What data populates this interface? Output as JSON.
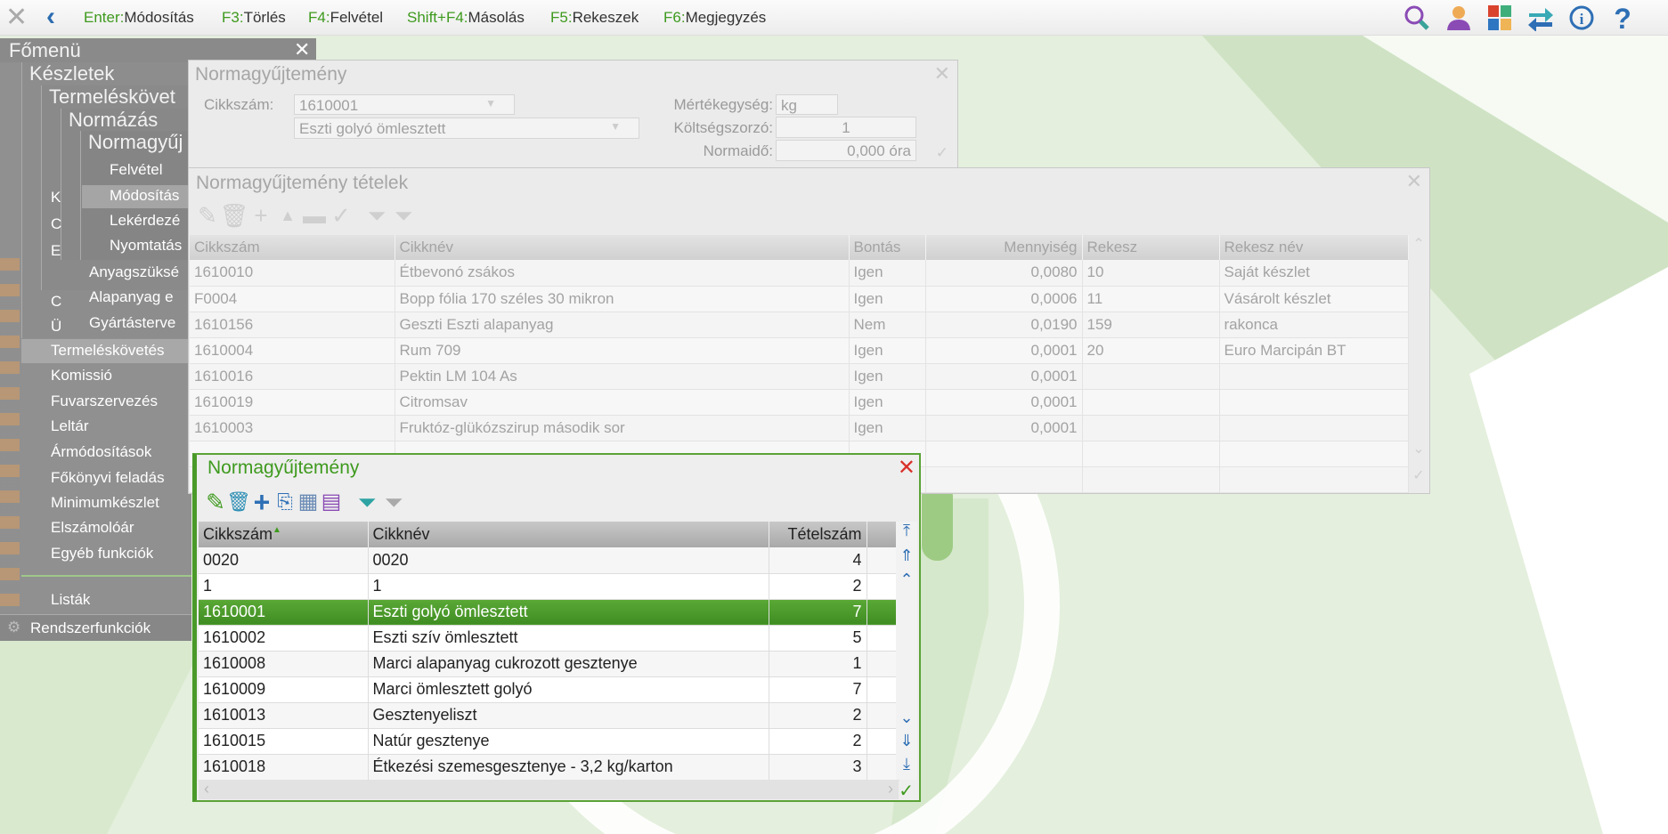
{
  "toolbar": {
    "shortcuts": [
      {
        "key": "Enter:",
        "label": "Módosítás"
      },
      {
        "key": "F3:",
        "label": "Törlés"
      },
      {
        "key": "F4:",
        "label": "Felvétel"
      },
      {
        "key": "Shift+F4:",
        "label": "Másolás"
      },
      {
        "key": "F5:",
        "label": "Rekeszek"
      },
      {
        "key": "F6:",
        "label": "Megjegyzés"
      }
    ],
    "icons": [
      "search-icon",
      "user-icon",
      "apps-grid-icon",
      "switch-icon",
      "info-icon",
      "help-icon"
    ]
  },
  "menu": {
    "title": "Főmenü",
    "levels": [
      "Készletek",
      "Termeléskövet",
      "Normázás",
      "Normagyűj"
    ],
    "norma_items": [
      "Felvétel",
      "Módosítás",
      "Lekérdezé",
      "Nyomtatás"
    ],
    "termeles_items": [
      "Anyagszüksé",
      "Alapanyag e",
      "Gyártásterve"
    ],
    "hidden_items": [
      "K",
      "C",
      "E",
      "C",
      "Ü"
    ],
    "items": [
      "Termeléskövetés",
      "Komissió",
      "Fuvarszervezés",
      "Leltár",
      "Ármódosítások",
      "Főkönyvi feladás",
      "Minimumkészlet",
      "Elszámolóár",
      "Egyéb funkciók",
      "Listák"
    ],
    "system": "Rendszerfunkciók"
  },
  "header_dialog": {
    "title": "Normagyűjtemény",
    "cikkszam_label": "Cikkszám:",
    "cikkszam": "1610001",
    "cikknev": "Eszti golyó ömlesztett",
    "me_label": "Mértékegység:",
    "me": "kg",
    "ksz_label": "Költségszorzó:",
    "ksz": "1",
    "nido_label": "Normaidő:",
    "nido": "0,000 óra"
  },
  "items_dialog": {
    "title": "Normagyűjtemény tételek",
    "columns": [
      "Cikkszám",
      "Cikknév",
      "Bontás",
      "Mennyiség",
      "Rekesz",
      "Rekesz név"
    ],
    "rows": [
      [
        "1610010",
        "Étbevonó zsákos",
        "Igen",
        "0,0080",
        "10",
        "Saját készlet"
      ],
      [
        "F0004",
        "Bopp fólia 170 széles 30 mikron",
        "Igen",
        "0,0006",
        "11",
        "Vásárolt készlet"
      ],
      [
        "1610156",
        "Geszti Eszti alapanyag",
        "Nem",
        "0,0190",
        "159",
        "rakonca"
      ],
      [
        "1610004",
        "Rum 709",
        "Igen",
        "0,0001",
        "20",
        "Euro Marcipán BT"
      ],
      [
        "1610016",
        "Pektin LM 104 As",
        "Igen",
        "0,0001",
        "",
        ""
      ],
      [
        "1610019",
        "Citromsav",
        "Igen",
        "0,0001",
        "",
        ""
      ],
      [
        "1610003",
        "Fruktóz-glükózszirup második sor",
        "Igen",
        "0,0001",
        "",
        ""
      ],
      [
        "",
        "",
        "",
        "",
        "",
        ""
      ],
      [
        "",
        "",
        "",
        "",
        "",
        ""
      ]
    ]
  },
  "list_dialog": {
    "title": "Normagyűjtemény",
    "columns": [
      "Cikkszám",
      "Cikknév",
      "Tételszám"
    ],
    "selected_index": 2,
    "rows": [
      [
        "0020",
        "0020",
        "4"
      ],
      [
        "1",
        "1",
        "2"
      ],
      [
        "1610001",
        "Eszti golyó ömlesztett",
        "7"
      ],
      [
        "1610002",
        "Eszti szív ömlesztett",
        "5"
      ],
      [
        "1610008",
        "Marci alapanyag cukrozott gesztenye",
        "1"
      ],
      [
        "1610009",
        "Marci ömlesztett golyó",
        "7"
      ],
      [
        "1610013",
        "Gesztenyeliszt",
        "2"
      ],
      [
        "1610015",
        "Natúr gesztenye",
        "2"
      ],
      [
        "1610018",
        "Étkezési szemesgesztenye - 3,2 kg/karton",
        "3"
      ]
    ]
  },
  "colors": {
    "accent": "#4a9a2a",
    "menu": "#8f8f8f",
    "close_red": "#d9302a"
  }
}
